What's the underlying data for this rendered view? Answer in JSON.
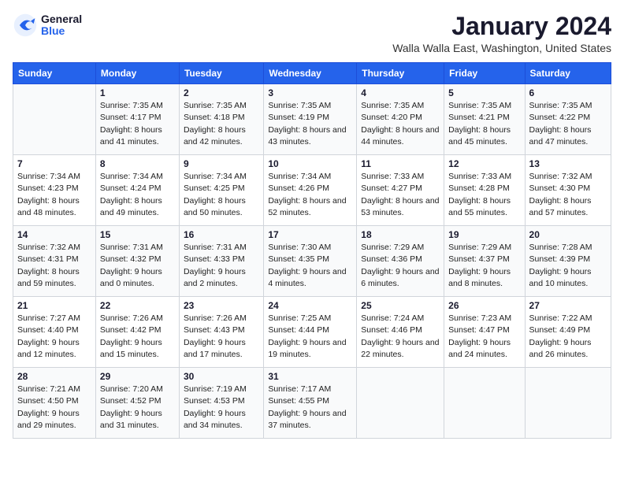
{
  "header": {
    "logo_general": "General",
    "logo_blue": "Blue",
    "month_title": "January 2024",
    "location": "Walla Walla East, Washington, United States"
  },
  "weekdays": [
    "Sunday",
    "Monday",
    "Tuesday",
    "Wednesday",
    "Thursday",
    "Friday",
    "Saturday"
  ],
  "weeks": [
    [
      {
        "day": "",
        "sunrise": "",
        "sunset": "",
        "daylight": ""
      },
      {
        "day": "1",
        "sunrise": "Sunrise: 7:35 AM",
        "sunset": "Sunset: 4:17 PM",
        "daylight": "Daylight: 8 hours and 41 minutes."
      },
      {
        "day": "2",
        "sunrise": "Sunrise: 7:35 AM",
        "sunset": "Sunset: 4:18 PM",
        "daylight": "Daylight: 8 hours and 42 minutes."
      },
      {
        "day": "3",
        "sunrise": "Sunrise: 7:35 AM",
        "sunset": "Sunset: 4:19 PM",
        "daylight": "Daylight: 8 hours and 43 minutes."
      },
      {
        "day": "4",
        "sunrise": "Sunrise: 7:35 AM",
        "sunset": "Sunset: 4:20 PM",
        "daylight": "Daylight: 8 hours and 44 minutes."
      },
      {
        "day": "5",
        "sunrise": "Sunrise: 7:35 AM",
        "sunset": "Sunset: 4:21 PM",
        "daylight": "Daylight: 8 hours and 45 minutes."
      },
      {
        "day": "6",
        "sunrise": "Sunrise: 7:35 AM",
        "sunset": "Sunset: 4:22 PM",
        "daylight": "Daylight: 8 hours and 47 minutes."
      }
    ],
    [
      {
        "day": "7",
        "sunrise": "Sunrise: 7:34 AM",
        "sunset": "Sunset: 4:23 PM",
        "daylight": "Daylight: 8 hours and 48 minutes."
      },
      {
        "day": "8",
        "sunrise": "Sunrise: 7:34 AM",
        "sunset": "Sunset: 4:24 PM",
        "daylight": "Daylight: 8 hours and 49 minutes."
      },
      {
        "day": "9",
        "sunrise": "Sunrise: 7:34 AM",
        "sunset": "Sunset: 4:25 PM",
        "daylight": "Daylight: 8 hours and 50 minutes."
      },
      {
        "day": "10",
        "sunrise": "Sunrise: 7:34 AM",
        "sunset": "Sunset: 4:26 PM",
        "daylight": "Daylight: 8 hours and 52 minutes."
      },
      {
        "day": "11",
        "sunrise": "Sunrise: 7:33 AM",
        "sunset": "Sunset: 4:27 PM",
        "daylight": "Daylight: 8 hours and 53 minutes."
      },
      {
        "day": "12",
        "sunrise": "Sunrise: 7:33 AM",
        "sunset": "Sunset: 4:28 PM",
        "daylight": "Daylight: 8 hours and 55 minutes."
      },
      {
        "day": "13",
        "sunrise": "Sunrise: 7:32 AM",
        "sunset": "Sunset: 4:30 PM",
        "daylight": "Daylight: 8 hours and 57 minutes."
      }
    ],
    [
      {
        "day": "14",
        "sunrise": "Sunrise: 7:32 AM",
        "sunset": "Sunset: 4:31 PM",
        "daylight": "Daylight: 8 hours and 59 minutes."
      },
      {
        "day": "15",
        "sunrise": "Sunrise: 7:31 AM",
        "sunset": "Sunset: 4:32 PM",
        "daylight": "Daylight: 9 hours and 0 minutes."
      },
      {
        "day": "16",
        "sunrise": "Sunrise: 7:31 AM",
        "sunset": "Sunset: 4:33 PM",
        "daylight": "Daylight: 9 hours and 2 minutes."
      },
      {
        "day": "17",
        "sunrise": "Sunrise: 7:30 AM",
        "sunset": "Sunset: 4:35 PM",
        "daylight": "Daylight: 9 hours and 4 minutes."
      },
      {
        "day": "18",
        "sunrise": "Sunrise: 7:29 AM",
        "sunset": "Sunset: 4:36 PM",
        "daylight": "Daylight: 9 hours and 6 minutes."
      },
      {
        "day": "19",
        "sunrise": "Sunrise: 7:29 AM",
        "sunset": "Sunset: 4:37 PM",
        "daylight": "Daylight: 9 hours and 8 minutes."
      },
      {
        "day": "20",
        "sunrise": "Sunrise: 7:28 AM",
        "sunset": "Sunset: 4:39 PM",
        "daylight": "Daylight: 9 hours and 10 minutes."
      }
    ],
    [
      {
        "day": "21",
        "sunrise": "Sunrise: 7:27 AM",
        "sunset": "Sunset: 4:40 PM",
        "daylight": "Daylight: 9 hours and 12 minutes."
      },
      {
        "day": "22",
        "sunrise": "Sunrise: 7:26 AM",
        "sunset": "Sunset: 4:42 PM",
        "daylight": "Daylight: 9 hours and 15 minutes."
      },
      {
        "day": "23",
        "sunrise": "Sunrise: 7:26 AM",
        "sunset": "Sunset: 4:43 PM",
        "daylight": "Daylight: 9 hours and 17 minutes."
      },
      {
        "day": "24",
        "sunrise": "Sunrise: 7:25 AM",
        "sunset": "Sunset: 4:44 PM",
        "daylight": "Daylight: 9 hours and 19 minutes."
      },
      {
        "day": "25",
        "sunrise": "Sunrise: 7:24 AM",
        "sunset": "Sunset: 4:46 PM",
        "daylight": "Daylight: 9 hours and 22 minutes."
      },
      {
        "day": "26",
        "sunrise": "Sunrise: 7:23 AM",
        "sunset": "Sunset: 4:47 PM",
        "daylight": "Daylight: 9 hours and 24 minutes."
      },
      {
        "day": "27",
        "sunrise": "Sunrise: 7:22 AM",
        "sunset": "Sunset: 4:49 PM",
        "daylight": "Daylight: 9 hours and 26 minutes."
      }
    ],
    [
      {
        "day": "28",
        "sunrise": "Sunrise: 7:21 AM",
        "sunset": "Sunset: 4:50 PM",
        "daylight": "Daylight: 9 hours and 29 minutes."
      },
      {
        "day": "29",
        "sunrise": "Sunrise: 7:20 AM",
        "sunset": "Sunset: 4:52 PM",
        "daylight": "Daylight: 9 hours and 31 minutes."
      },
      {
        "day": "30",
        "sunrise": "Sunrise: 7:19 AM",
        "sunset": "Sunset: 4:53 PM",
        "daylight": "Daylight: 9 hours and 34 minutes."
      },
      {
        "day": "31",
        "sunrise": "Sunrise: 7:17 AM",
        "sunset": "Sunset: 4:55 PM",
        "daylight": "Daylight: 9 hours and 37 minutes."
      },
      {
        "day": "",
        "sunrise": "",
        "sunset": "",
        "daylight": ""
      },
      {
        "day": "",
        "sunrise": "",
        "sunset": "",
        "daylight": ""
      },
      {
        "day": "",
        "sunrise": "",
        "sunset": "",
        "daylight": ""
      }
    ]
  ]
}
